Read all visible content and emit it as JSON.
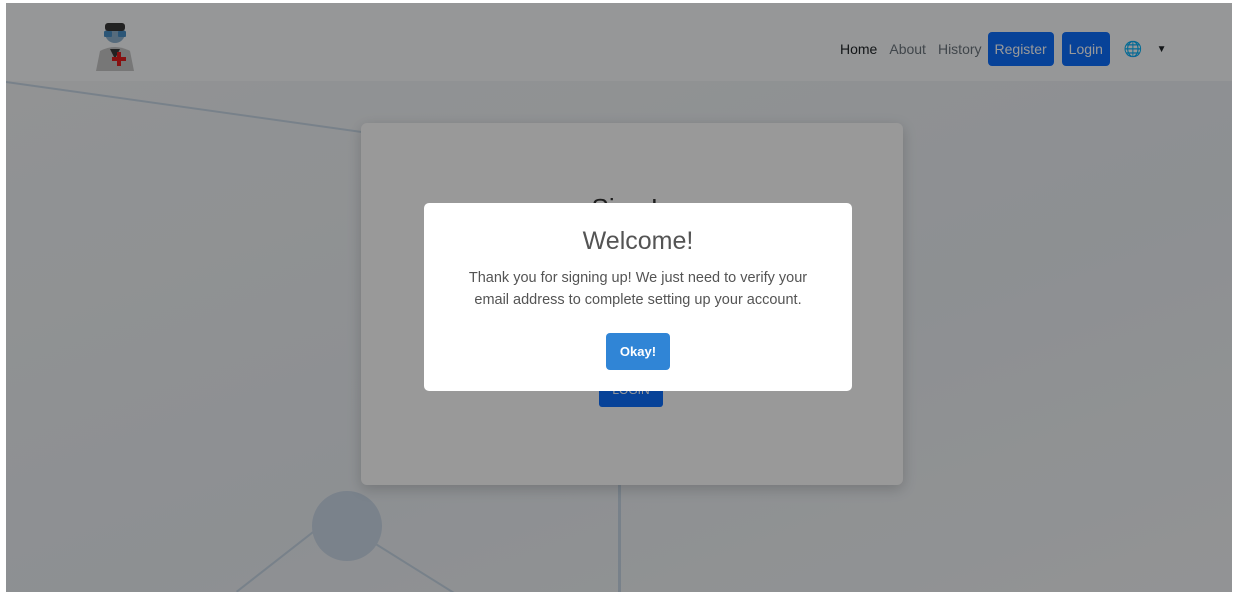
{
  "nav": {
    "home": "Home",
    "about": "About",
    "history": "History",
    "register": "Register",
    "login": "Login",
    "language_icon": "globe-icon",
    "dropdown_icon": "caret-down-icon"
  },
  "background_card": {
    "title_fragment": "Sign In",
    "button_fragment": "LOGIN"
  },
  "modal": {
    "title": "Welcome!",
    "message": "Thank you for signing up! We just need to verify your email address to complete setting up your account.",
    "confirm_label": "Okay!"
  },
  "colors": {
    "primary": "#0d6efd",
    "modal_button": "#3085d6",
    "overlay": "rgba(0,0,0,0.4)"
  }
}
